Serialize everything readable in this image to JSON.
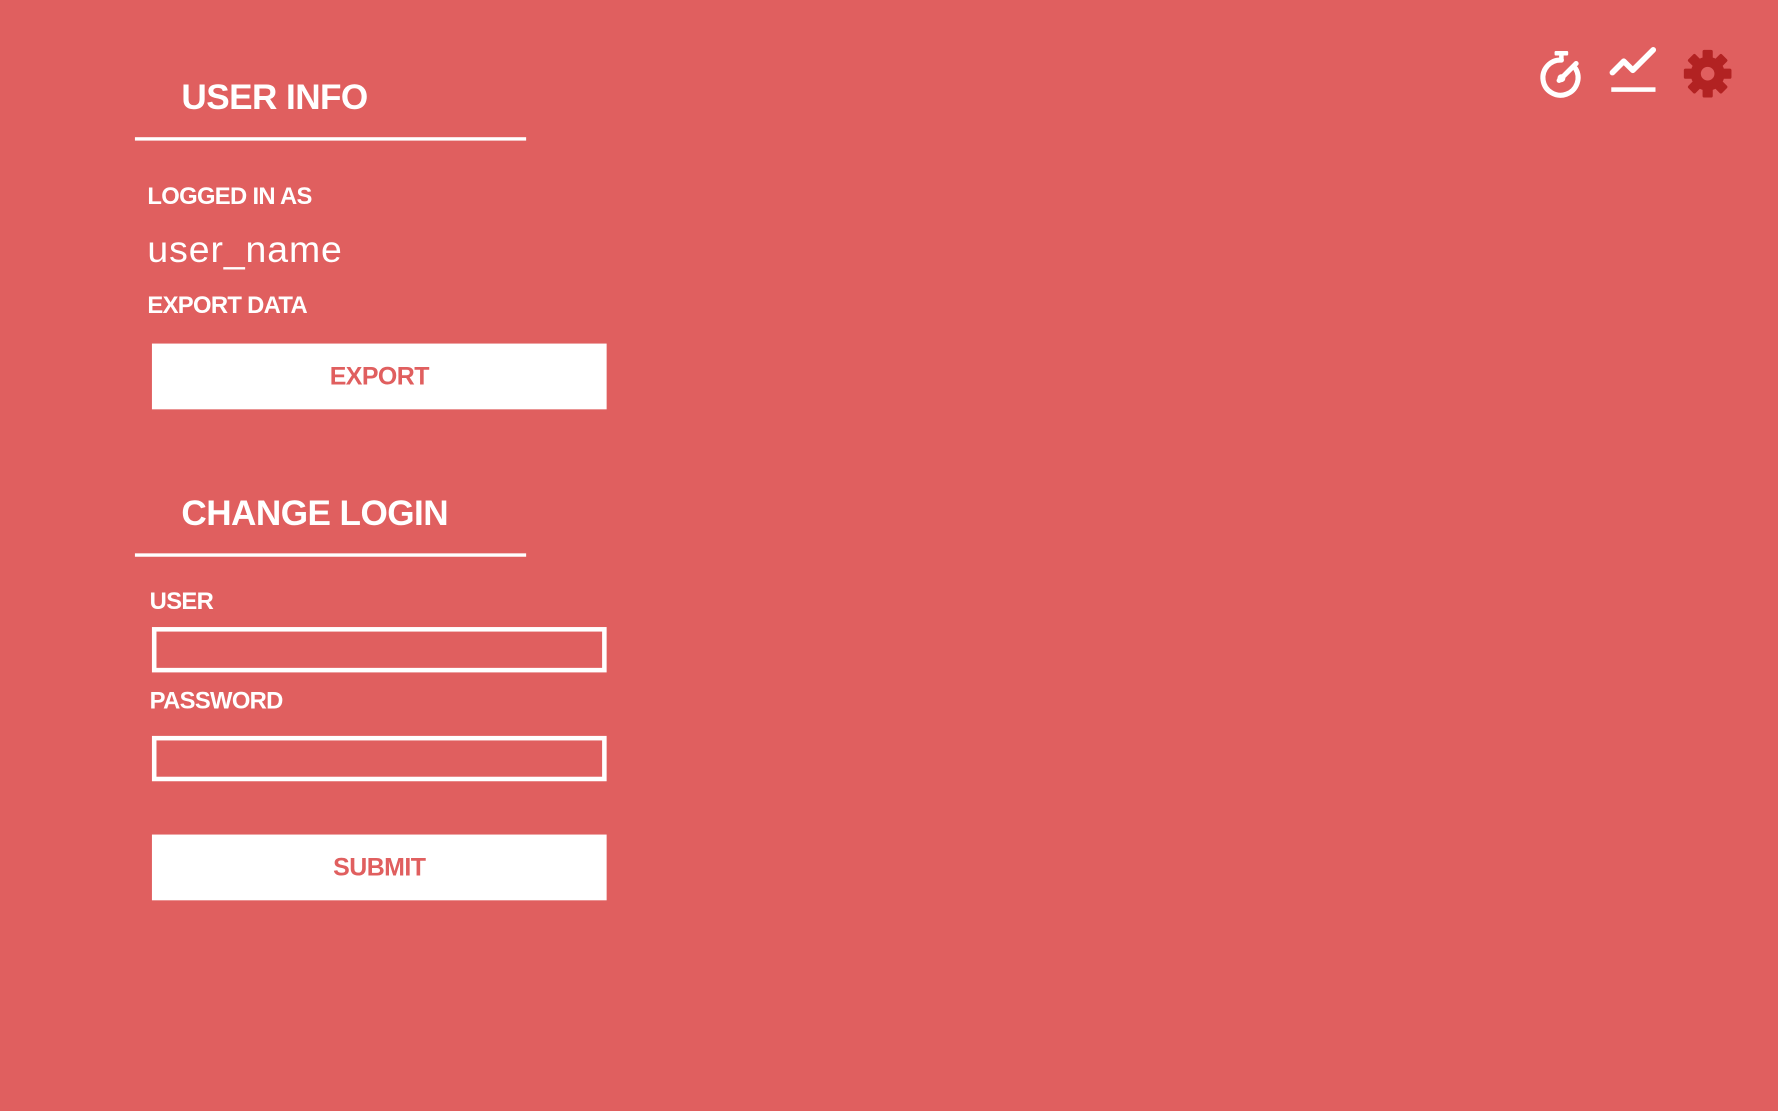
{
  "header": {
    "icons": [
      {
        "name": "timer-icon",
        "color": "#ffffff"
      },
      {
        "name": "stats-icon",
        "color": "#ffffff"
      },
      {
        "name": "settings-icon",
        "color": "#b22222",
        "active": true
      }
    ]
  },
  "user_info": {
    "title": "USER INFO",
    "logged_in_label": "LOGGED IN AS",
    "username": "user_name",
    "export_label": "EXPORT DATA",
    "export_button": "EXPORT"
  },
  "change_login": {
    "title": "CHANGE LOGIN",
    "user_label": "USER",
    "user_value": "",
    "password_label": "PASSWORD",
    "password_value": "",
    "submit_button": "SUBMIT"
  },
  "colors": {
    "background": "#e05f5f",
    "foreground": "#ffffff",
    "active_icon": "#b22222"
  }
}
